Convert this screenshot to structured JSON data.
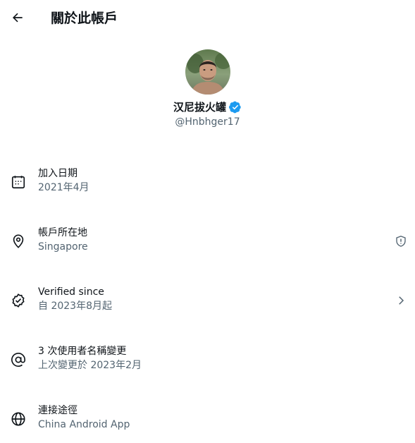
{
  "header": {
    "title": "關於此帳戶"
  },
  "profile": {
    "display_name": "汉尼拔火罐",
    "handle": "@Hnbhger17",
    "verified": true,
    "verified_color": "#1d9bf0"
  },
  "rows": [
    {
      "icon": "calendar-icon",
      "title": "加入日期",
      "subtitle": "2021年4月"
    },
    {
      "icon": "location-pin-icon",
      "title": "帳戶所在地",
      "subtitle": "Singapore",
      "right_icon": "shield-icon"
    },
    {
      "icon": "verified-badge-icon",
      "title": "Verified since",
      "subtitle": "自 2023年8月起",
      "right_icon": "chevron-right-icon"
    },
    {
      "icon": "at-sign-icon",
      "title": "3 次使用者名稱變更",
      "subtitle": "上次變更於 2023年2月"
    },
    {
      "icon": "globe-icon",
      "title": "連接途徑",
      "subtitle": "China Android App"
    }
  ],
  "colors": {
    "primary_text": "#0f1419",
    "secondary_text": "#536471"
  }
}
